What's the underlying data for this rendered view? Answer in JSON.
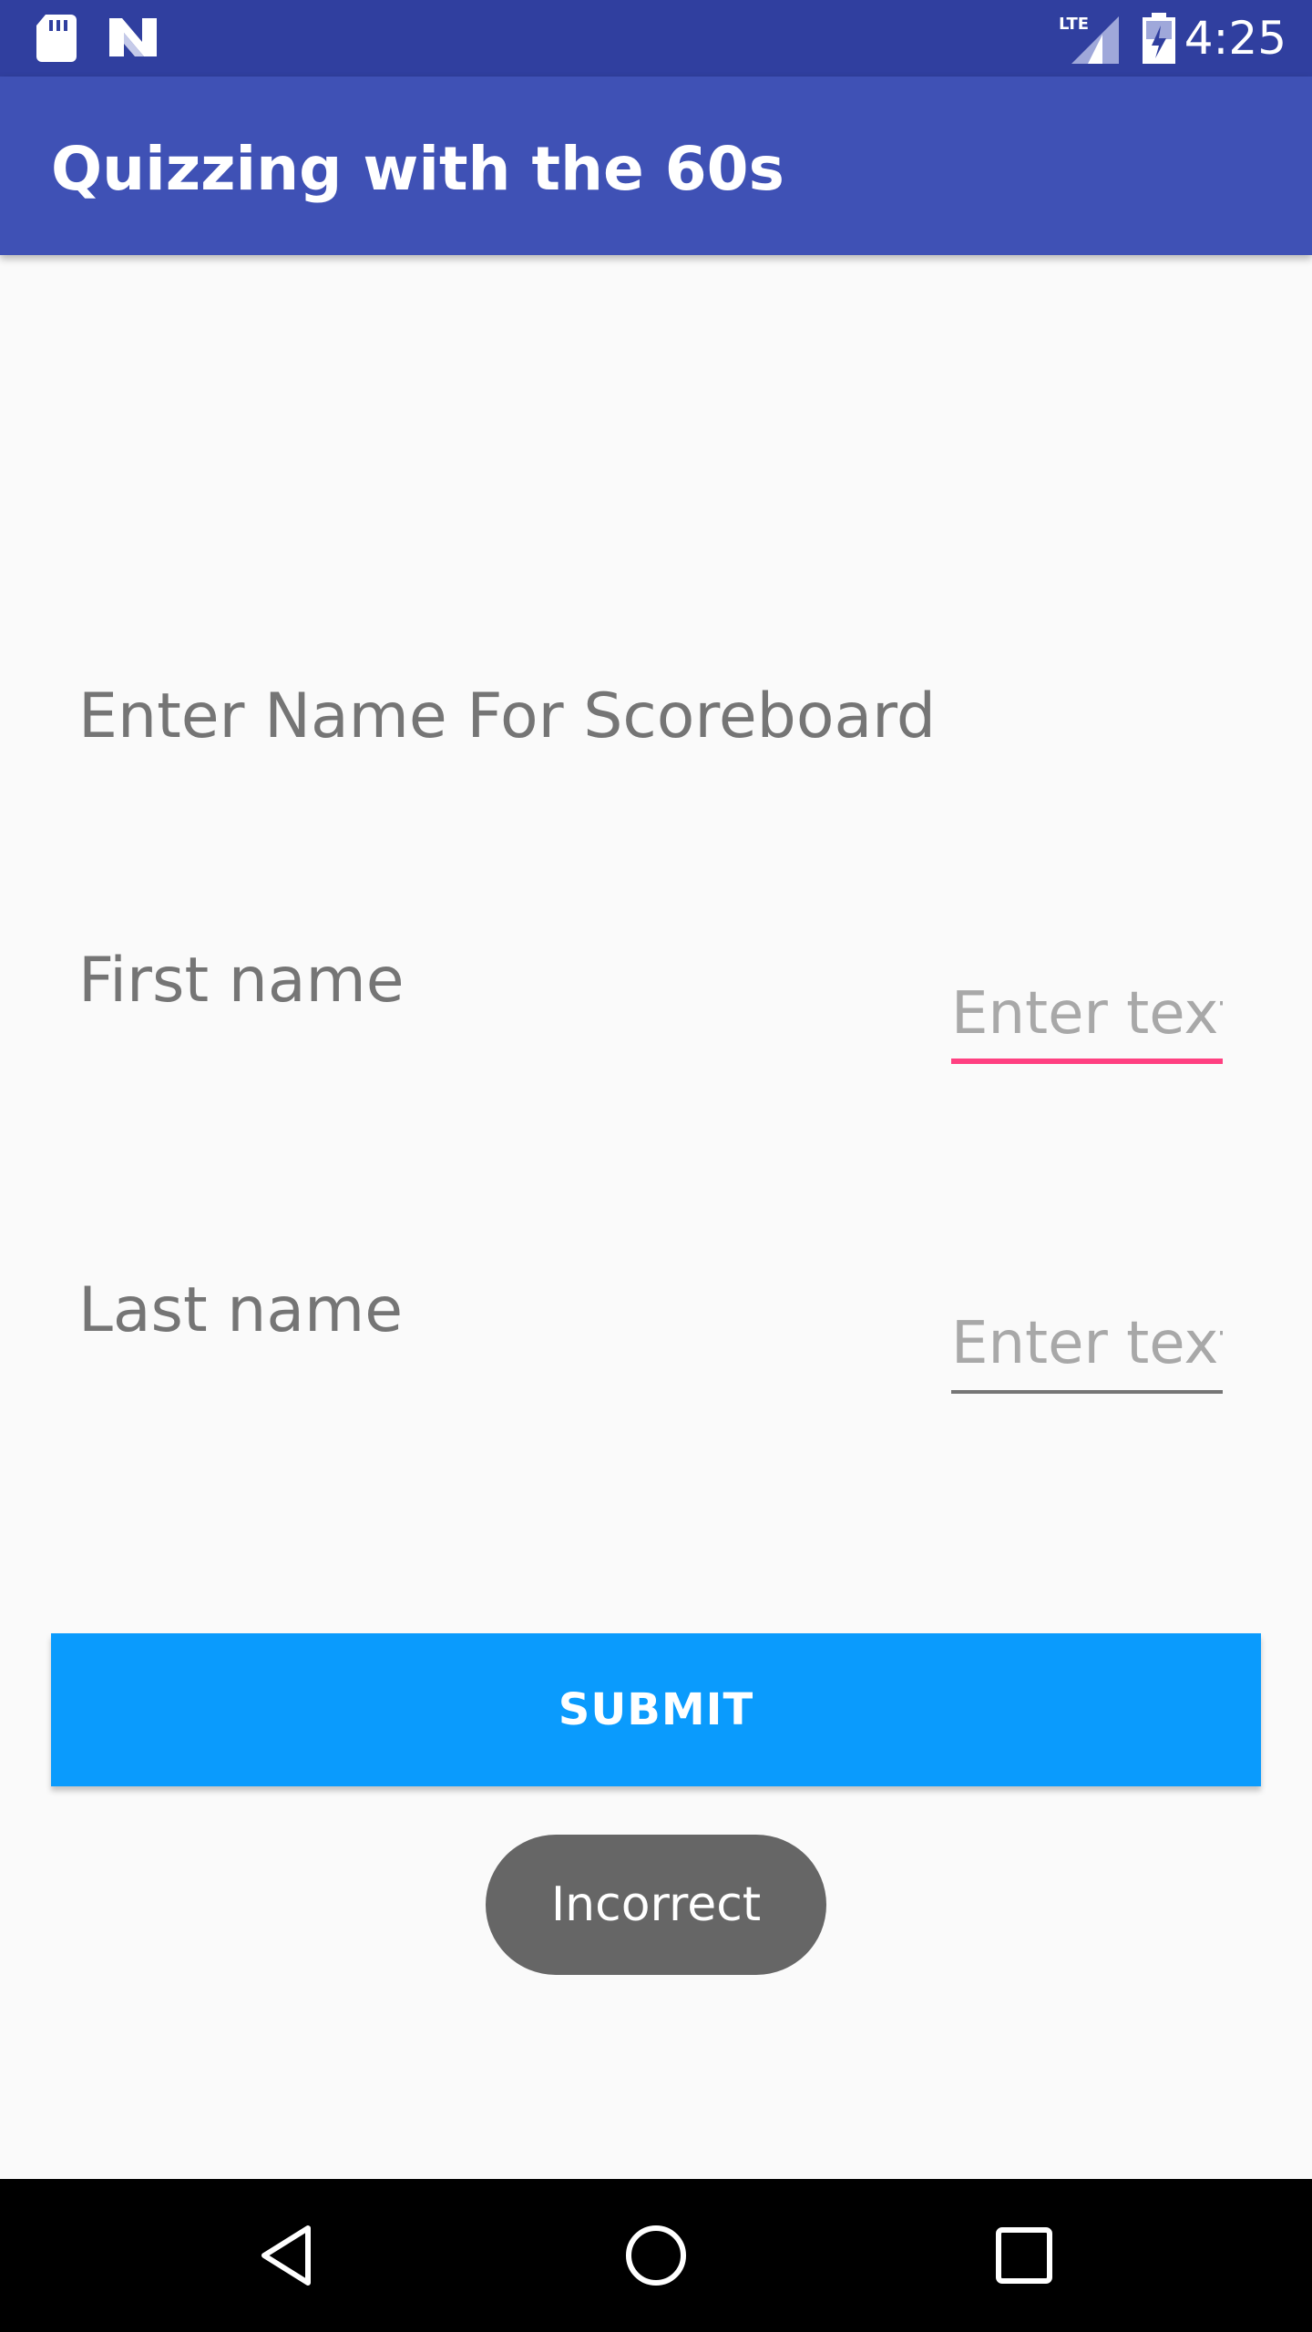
{
  "status_bar": {
    "time": "4:25",
    "network": "LTE",
    "icons": [
      "sd-card-icon",
      "n-notification-icon",
      "lte-signal-icon",
      "battery-charging-icon"
    ]
  },
  "app_bar": {
    "title": "Quizzing with the 60s"
  },
  "form": {
    "heading": "Enter Name For Scoreboard",
    "first_name_label": "First name",
    "first_name_placeholder": "Enter text",
    "first_name_value": "",
    "last_name_label": "Last name",
    "last_name_placeholder": "Enter text",
    "last_name_value": "",
    "submit_label": "SUBMIT"
  },
  "toast": {
    "message": "Incorrect"
  },
  "nav_bar": {
    "icons": [
      "back-icon",
      "home-icon",
      "recents-icon"
    ]
  },
  "colors": {
    "status_bar": "#303f9f",
    "app_bar": "#3f51b5",
    "submit_button": "#0a9bfd",
    "focus_accent": "#ff4081",
    "toast": "#666666",
    "background": "#fafafa"
  }
}
